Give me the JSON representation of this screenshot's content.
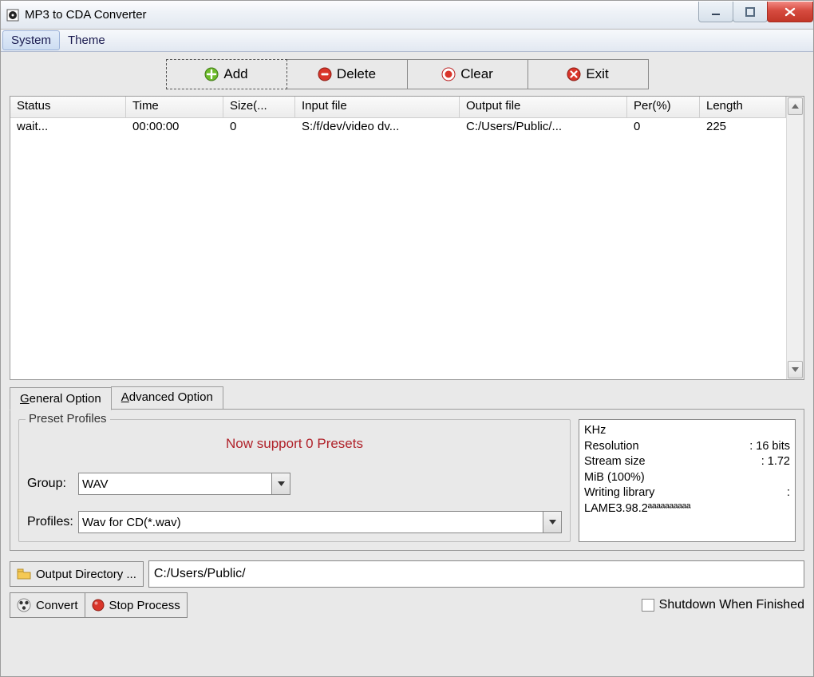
{
  "title": "MP3 to CDA Converter",
  "menu": {
    "system": "System",
    "theme": "Theme"
  },
  "toolbar": {
    "add": "Add",
    "delete": "Delete",
    "clear": "Clear",
    "exit": "Exit"
  },
  "list": {
    "headers": {
      "status": "Status",
      "time": "Time",
      "size": "Size(...",
      "input": "Input file",
      "output": "Output file",
      "per": "Per(%)",
      "length": "Length"
    },
    "rows": [
      {
        "status": "wait...",
        "time": "00:00:00",
        "size": "0",
        "input": "S:/f/dev/video dv...",
        "output": "C:/Users/Public/...",
        "per": "0",
        "length": "225"
      }
    ]
  },
  "tabs": {
    "general": "eneral Option",
    "general_mn": "G",
    "advanced": "dvanced Option",
    "advanced_mn": "A"
  },
  "presets": {
    "legend": "Preset Profiles",
    "message": "Now support 0 Presets",
    "group_label": "Group:",
    "group_value": "WAV",
    "profiles_label": "Profiles:",
    "profiles_value": "Wav for CD(*.wav)"
  },
  "info": {
    "khz": "KHz",
    "resolution_k": "Resolution",
    "resolution_v": ": 16 bits",
    "stream_k": "Stream size",
    "stream_v": ": 1.72",
    "mib": "MiB (100%)",
    "wl_k": "Writing library",
    "wl_v": ":",
    "lame": "LAME3.98.2ªªªªªªªªªª"
  },
  "output": {
    "button": "Output Directory ...",
    "path": "C:/Users/Public/"
  },
  "actions": {
    "convert": "Convert",
    "stop": "Stop Process",
    "shutdown": "Shutdown When Finished"
  }
}
